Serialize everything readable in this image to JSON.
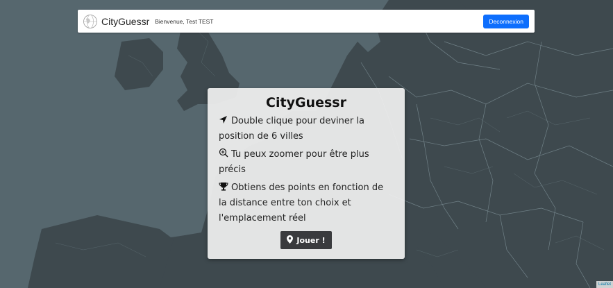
{
  "navbar": {
    "brand": "CityGuessr",
    "welcome": "Bienvenue, Test TEST",
    "logout_label": "Deconnexion"
  },
  "modal": {
    "title": "CityGuessr",
    "rules": [
      {
        "icon": "location-arrow-icon",
        "text": "Double clique pour deviner la position de 6 villes"
      },
      {
        "icon": "zoom-in-icon",
        "text": "Tu peux zoomer pour être plus précis"
      },
      {
        "icon": "trophy-icon",
        "text": "Obtiens des points en fonction de la distance entre ton choix et l'emplacement réel"
      }
    ],
    "play_label": "Jouer !",
    "play_icon": "map-marker-icon"
  },
  "map": {
    "attribution": "Leaflet",
    "colors": {
      "sea": "#55666d",
      "land": "#3f4a4f",
      "borders": "#8899a0"
    }
  }
}
